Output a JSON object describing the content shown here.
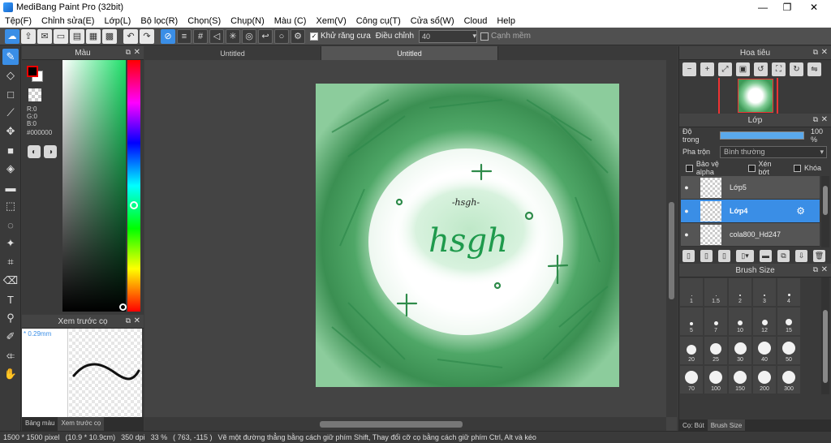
{
  "window": {
    "title": "MediBang Paint Pro (32bit)",
    "minimize": "—",
    "maximize": "❐",
    "close": "✕"
  },
  "menu": [
    "Tệp(F)",
    "Chỉnh sửa(E)",
    "Lớp(L)",
    "Bộ lọc(R)",
    "Chọn(S)",
    "Chụp(N)",
    "Màu (C)",
    "Xem(V)",
    "Công cụ(T)",
    "Cửa sổ(W)",
    "Cloud",
    "Help"
  ],
  "toolbar": {
    "antialias_label": "Khử răng cưa",
    "adjust_label": "Điều chỉnh",
    "adjust_value": "40",
    "edge_label": "Cạnh mềm"
  },
  "color_panel": {
    "title": "Màu",
    "r": "R:0",
    "g": "G:0",
    "b": "B:0",
    "hex": "#000000",
    "fg_color": "#000000",
    "bg_color": "#ffffff"
  },
  "brush_preview": {
    "title": "Xem trước cọ",
    "size": "* 0.29mm"
  },
  "left_tabs": [
    "Bảng màu",
    "Xem trước cọ"
  ],
  "document_tabs": [
    "Untitled",
    "Untitled"
  ],
  "canvas": {
    "text": "hsgh",
    "small_text": "-hsgh-"
  },
  "navigator": {
    "title": "Hoa tiêu"
  },
  "layers": {
    "title": "Lớp",
    "opacity_label": "Độ trong",
    "opacity_value": "100 %",
    "opacity_fraction": 1.0,
    "blend_label": "Pha trộn",
    "blend_value": "Bình thường",
    "protect_alpha": "Bảo vệ alpha",
    "clipping": "Xén bớt",
    "lock": "Khóa",
    "items": [
      {
        "name": "Lớp5",
        "selected": false
      },
      {
        "name": "Lớp4",
        "selected": true
      },
      {
        "name": "cola800_Hd247",
        "selected": false
      }
    ]
  },
  "brush_size": {
    "title": "Brush Size",
    "sizes": [
      "1",
      "1.5",
      "2",
      "3",
      "4",
      "5",
      "7",
      "10",
      "12",
      "15",
      "20",
      "25",
      "30",
      "40",
      "50",
      "70",
      "100",
      "150",
      "200",
      "300"
    ]
  },
  "right_tabs": [
    "Cọ: Bút",
    "Brush Size"
  ],
  "status": {
    "size_px": "1500 * 1500 pixel",
    "size_cm": "(10.9 * 10.9cm)",
    "dpi": "350 dpi",
    "zoom": "33 %",
    "coords": "( 763, -115 )",
    "hint": "Vẽ một đường thẳng bằng cách giữ phím Shift, Thay đổi cỡ cọ bằng cách giữ phím Ctrl, Alt và kéo"
  },
  "colors": {
    "accent": "#3a8ee6",
    "canvas_green": "#2e8b4a"
  }
}
